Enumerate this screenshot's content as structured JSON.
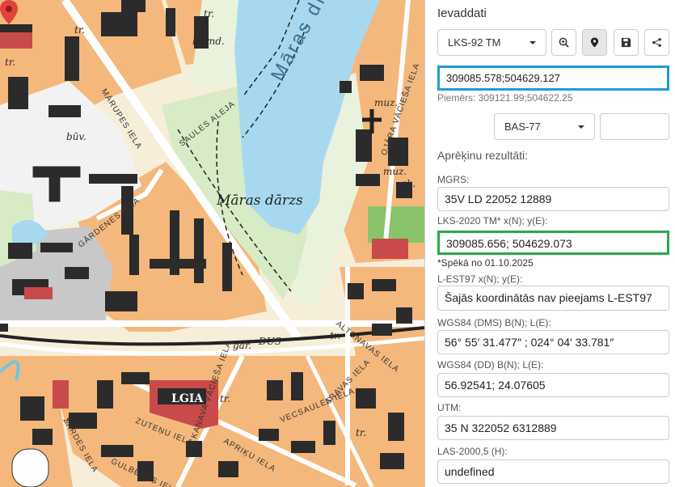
{
  "map": {
    "water_label": "Māras dīķis",
    "place_label": "Māras dārzs",
    "streets": [
      "MĀRUPES IELA",
      "SAULES ALEJA",
      "GĀRDENES IELA",
      "ALTONAVAS IELA",
      "OJĀRA VĀCIEŠA IELA",
      "ZUTEŅU IELA",
      "APRIĶU IELA",
      "VECSAULES IELA",
      "ARAVAS IELA",
      "GULBENES IELA",
      "ŽĀRDES IELA",
      "KAŅAVA VĀCIEŠA IELA"
    ],
    "small_labels": [
      "tr.",
      "tr.",
      "būv.",
      "bērnd.",
      "muz.",
      "muz.",
      "sk.",
      "tr.",
      "tr.",
      "tr.",
      "gar.",
      "DUS",
      "tr.",
      "sk.",
      "tr."
    ],
    "lgia_label": "LGIA"
  },
  "panel": {
    "title": "Ievaddati",
    "projection_select": "LKS-92 TM",
    "input_coords": "309085.578;504629.127",
    "example": "Piemērs: 309121.99;504622.25",
    "height_select": "BAS-77",
    "height_input": "",
    "results_title": "Aprēķinu rezultāti:",
    "mgrs_label": "MGRS:",
    "mgrs_value": "35V LD 22052 12889",
    "lks2020_label": "LKS-2020 TM* x(N); y(E):",
    "lks2020_value": "309085.656; 504629.073",
    "lks2020_note": "*Spēkā no 01.10.2025",
    "lest_label": "L-EST97 x(N); y(E):",
    "lest_value": "Šajās koordinātās nav pieejams L-EST97",
    "wgs_dms_label": "WGS84 (DMS) B(N); L(E):",
    "wgs_dms_value": "56° 55′ 31.477″ ;  024° 04′ 33.781″",
    "wgs_dd_label": "WGS84 (DD) B(N); L(E):",
    "wgs_dd_value": "56.92541; 24.07605",
    "utm_label": "UTM:",
    "utm_value": "35 N 322052 6312889",
    "las_label": "LAS-2000,5 (H):",
    "las_value": "undefined"
  },
  "icons": [
    "zoom-icon",
    "location-pin-icon",
    "save-icon",
    "share-icon",
    "map-marker-icon"
  ],
  "colors": {
    "accent_blue": "#1f9bd7",
    "accent_green": "#2aa84a",
    "water": "#a8d8f0",
    "park": "#d6ebc6",
    "built": "#f4b87c",
    "building": "#2b2b2b"
  }
}
